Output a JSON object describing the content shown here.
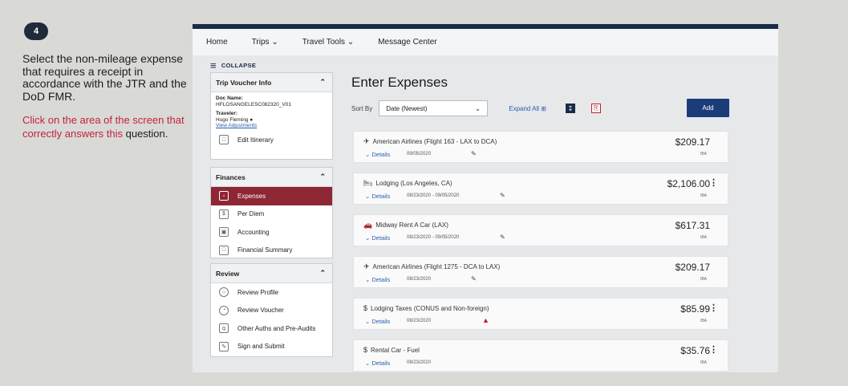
{
  "question": {
    "number": "4",
    "text": "Select the non-mileage expense that requires a receipt in accordance with the JTR and the DoD FMR.",
    "instruction_red": "Click on the area of the screen that correctly answers this",
    "instruction_dark": "question."
  },
  "nav": {
    "items": [
      "Home",
      "Trips ⌄",
      "Travel Tools ⌄",
      "Message Center"
    ]
  },
  "sidebar": {
    "collapse_label": "COLLAPSE",
    "trip_voucher": {
      "title": "Trip Voucher Info",
      "doc_name_label": "Doc Name:",
      "doc_name_value": "HFLOSANGELESC082320_V01",
      "traveler_label": "Traveler:",
      "traveler_value": "Hugo Fleming",
      "view_adjustments": "View Adjustments",
      "edit_itinerary": "Edit Itinerary"
    },
    "finances": {
      "title": "Finances",
      "items": [
        "Expenses",
        "Per Diem",
        "Accounting",
        "Financial Summary"
      ]
    },
    "review": {
      "title": "Review",
      "items": [
        "Review Profile",
        "Review Voucher",
        "Other Auths and Pre-Audits",
        "Sign and Submit"
      ]
    }
  },
  "main": {
    "title": "Enter Expenses",
    "sort_label": "Sort By",
    "sort_value": "Date (Newest)",
    "expand_all": "Expand All",
    "add_button": "Add",
    "details_label": "Details",
    "expenses": [
      {
        "title": "American Airlines (Flight 163 - LAX to DCA)",
        "date": "09/05/2020",
        "amount": "$209.17",
        "tag": "IBA",
        "icon": "plane-icon",
        "warning": false,
        "menu": false
      },
      {
        "title": "Lodging (Los Angeles, CA)",
        "date": "08/23/2020 - 09/05/2020",
        "amount": "$2,106.00",
        "tag": "IBA",
        "icon": "bed-icon",
        "warning": false,
        "menu": true
      },
      {
        "title": "Midway Rent A Car (LAX)",
        "date": "08/23/2020 - 09/05/2020",
        "amount": "$617.31",
        "tag": "IBA",
        "icon": "car-icon",
        "warning": false,
        "menu": false
      },
      {
        "title": "American Airlines (Flight 1275 - DCA to LAX)",
        "date": "08/23/2020",
        "amount": "$209.17",
        "tag": "IBA",
        "icon": "plane-icon",
        "warning": false,
        "menu": false
      },
      {
        "title": "Lodging Taxes (CONUS and Non-foreign)",
        "date": "08/23/2020",
        "amount": "$85.99",
        "tag": "IBA",
        "icon": "dollar-icon",
        "warning": true,
        "menu": true
      },
      {
        "title": "Rental Car - Fuel",
        "date": "08/23/2020",
        "amount": "$35.76",
        "tag": "IBA",
        "icon": "dollar-icon",
        "warning": false,
        "menu": true
      }
    ]
  },
  "colors": {
    "navy": "#1a2b48",
    "active_item": "#8e2634",
    "instruction": "#c2233c",
    "link": "#2a5db0"
  }
}
